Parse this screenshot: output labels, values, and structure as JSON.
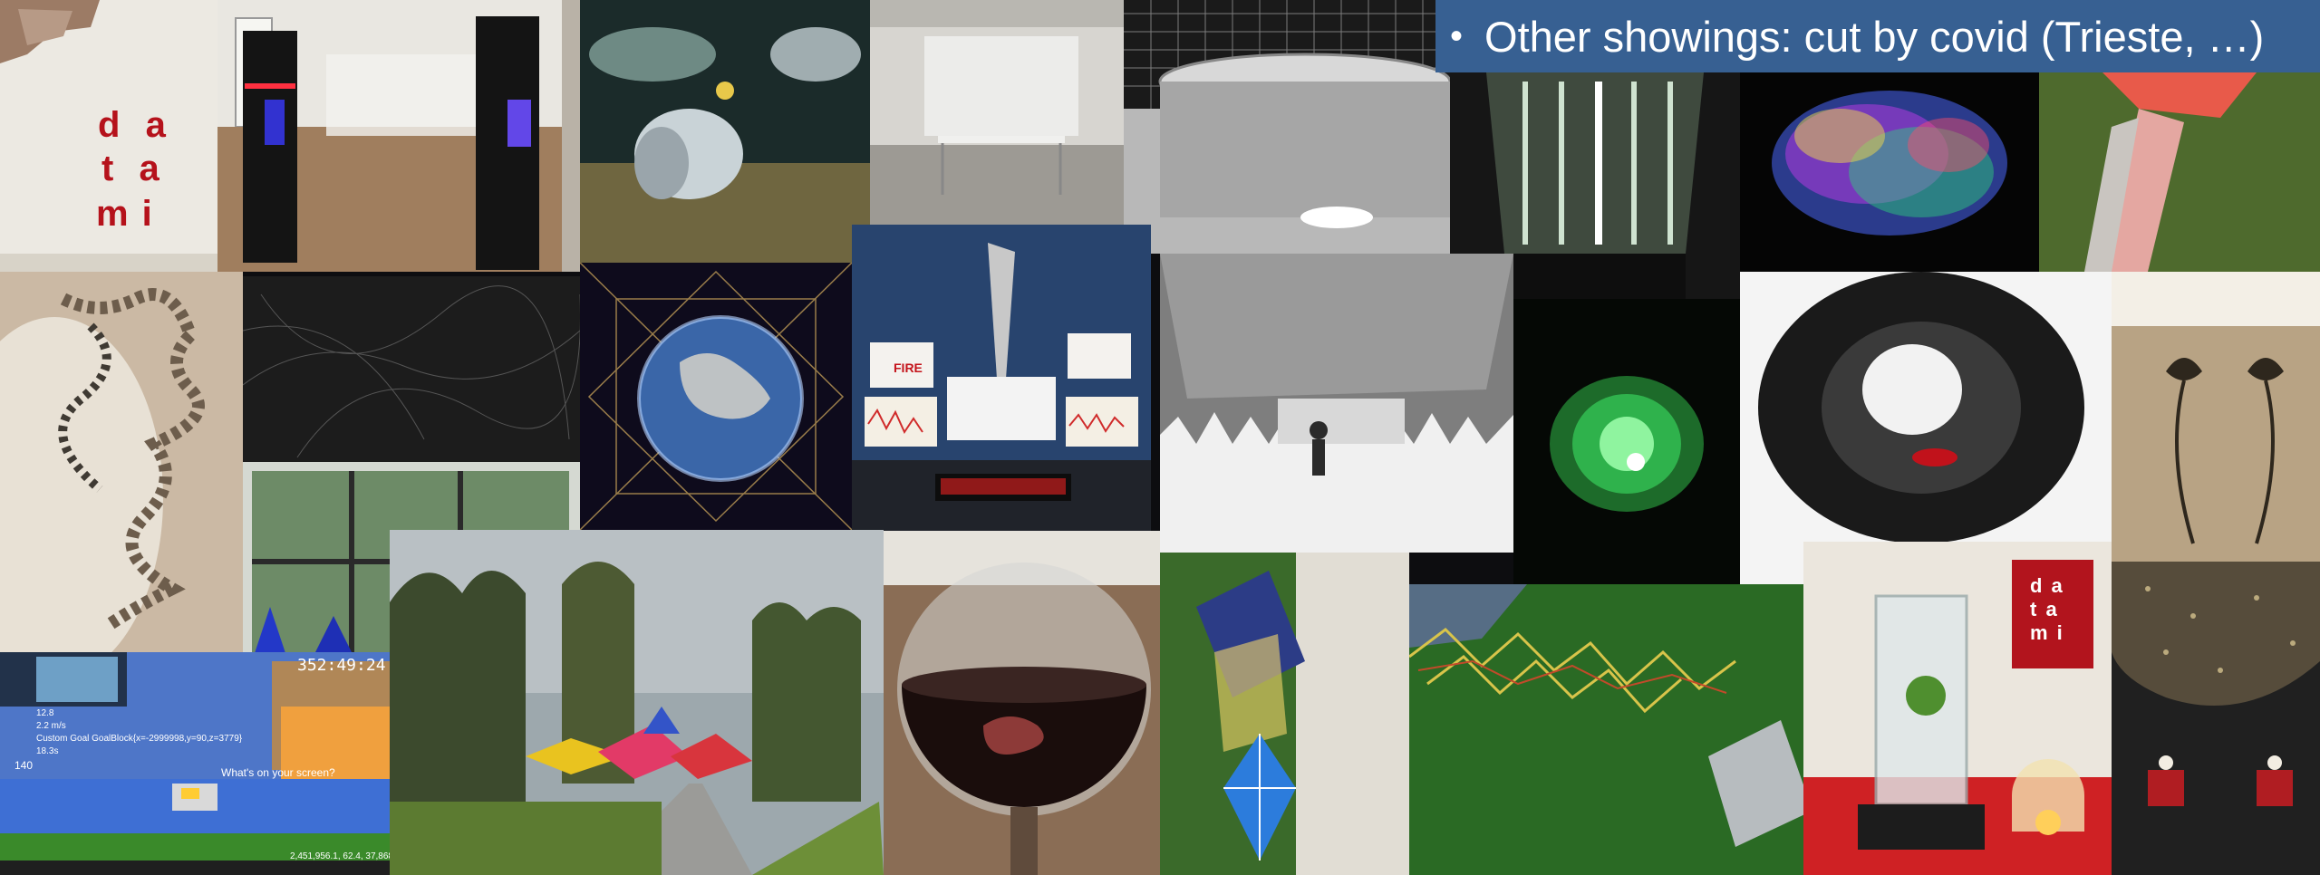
{
  "banner": {
    "bullet": "•",
    "text": "Other showings: cut by covid (Trieste, …)"
  },
  "datami_logo": {
    "row1": "d  a",
    "row2": "t  a",
    "row3": "m i"
  },
  "datami_small": {
    "row1": "d a",
    "row2": "t a",
    "row3": "m i"
  },
  "sign_label": "FIRE",
  "minecraft": {
    "clock": "352:49:24",
    "chat_message": "What's on your screen?",
    "hud_lines": [
      "12.8",
      "2.2 m/s",
      "Custom Goal GoalBlock{x=-2999998,y=90,z=3779}",
      "18.3s"
    ],
    "level": "140",
    "coords": "2,451,956.1, 62.4, 37,868.8"
  },
  "colors": {
    "banner_bg": "#376092",
    "datami_red": "#b5121b"
  }
}
